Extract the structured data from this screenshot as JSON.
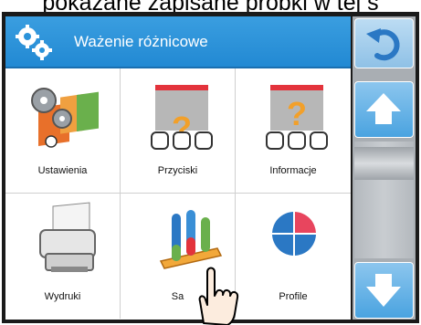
{
  "caption": "pokazane zapisane próbki w tej s",
  "header": {
    "title": "Ważenie różnicowe",
    "icon": "gears-icon"
  },
  "tiles": [
    {
      "label": "Ustawienia",
      "icon": "settings-icon"
    },
    {
      "label": "Przyciski",
      "icon": "buttons-icon"
    },
    {
      "label": "Informacje",
      "icon": "info-icon"
    },
    {
      "label": "Wydruki",
      "icon": "printer-icon"
    },
    {
      "label": "Sa",
      "icon": "samples-icon"
    },
    {
      "label": "Profile",
      "icon": "profile-icon"
    }
  ],
  "sidebar": {
    "back": "back-arrow-icon",
    "up": "arrow-up-icon",
    "down": "arrow-down-icon"
  },
  "colors": {
    "header": "#2a93da",
    "accent_red": "#e8455e",
    "accent_blue": "#2b78c4"
  }
}
